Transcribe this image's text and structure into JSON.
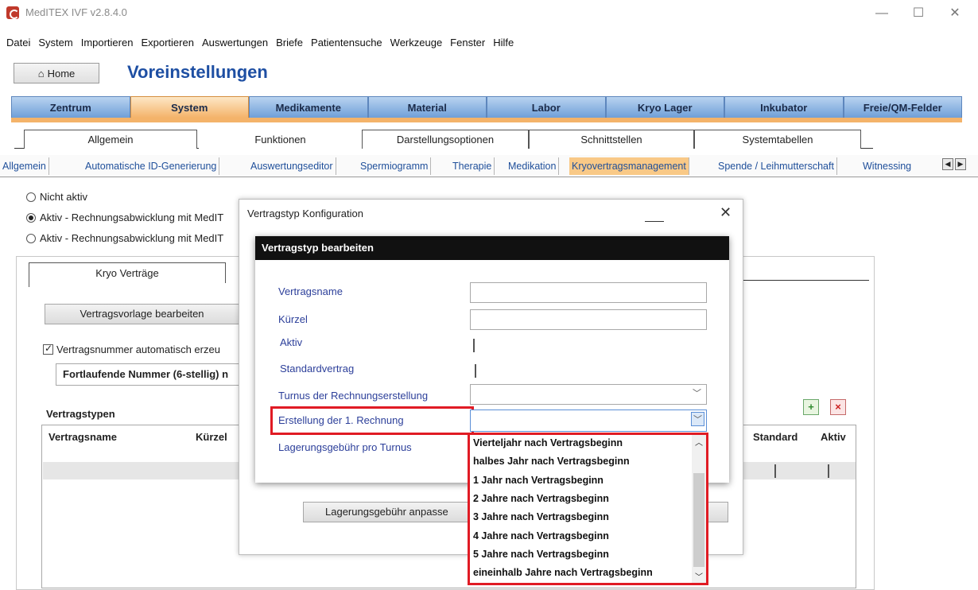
{
  "window": {
    "title": "MedITEX IVF v2.8.4.0",
    "minimize": "—",
    "maximize": "☐",
    "close": "✕"
  },
  "menu": [
    "Datei",
    "System",
    "Importieren",
    "Exportieren",
    "Auswertungen",
    "Briefe",
    "Patientensuche",
    "Werkzeuge",
    "Fenster",
    "Hilfe"
  ],
  "header": {
    "home_label": "Home",
    "heading": "Voreinstellungen"
  },
  "main_tabs": [
    "Zentrum",
    "System",
    "Medikamente",
    "Material",
    "Labor",
    "Kryo Lager",
    "Inkubator",
    "Freie/QM-Felder"
  ],
  "sub_tabs": [
    "Allgemein",
    "Funktionen",
    "Darstellungsoptionen",
    "Schnittstellen",
    "Systemtabellen"
  ],
  "third_tabs": [
    "Allgemein",
    "Automatische ID-Generierung",
    "Auswertungseditor",
    "Spermiogramm",
    "Therapie",
    "Medikation",
    "Kryovertragsmanagement",
    "Spende / Leihmutterschaft",
    "Witnessing"
  ],
  "radios": [
    {
      "label": "Nicht aktiv",
      "checked": false
    },
    {
      "label": "Aktiv - Rechnungsabwicklung mit MedIT",
      "checked": true
    },
    {
      "label": "Aktiv - Rechnungsabwicklung mit MedIT",
      "checked": false
    }
  ],
  "panel": {
    "tab_label": "Kryo Verträge",
    "edit_template_button": "Vertragsvorlage bearbeiten",
    "auto_number_label": "Vertragsnummer automatisch erzeu",
    "number_format": "Fortlaufende Nummer (6-stellig) n",
    "types_heading": "Vertragstypen",
    "columns": {
      "name": "Vertragsname",
      "short": "Kürzel",
      "standard": "Standard",
      "active": "Aktiv"
    },
    "fee_button": "Lagerungsgebühr anpasse"
  },
  "dialog": {
    "title": "Vertragstyp Konfiguration",
    "close": "✕",
    "heading": "Vertragstyp bearbeiten",
    "labels": {
      "name": "Vertragsname",
      "short": "Kürzel",
      "active": "Aktiv",
      "standard": "Standardvertrag",
      "turnus": "Turnus der Rechnungserstellung",
      "first_invoice": "Erstellung der 1. Rechnung",
      "fee": "Lagerungsgebühr pro Turnus"
    }
  },
  "dropdown": {
    "options": [
      "Vierteljahr nach Vertragsbeginn",
      "halbes Jahr nach Vertragsbeginn",
      "1 Jahr nach Vertragsbeginn",
      "2 Jahre nach Vertragsbeginn",
      "3 Jahre nach Vertragsbeginn",
      "4 Jahre nach Vertragsbeginn",
      "5 Jahre nach Vertragsbeginn",
      "eineinhalb Jahre nach Vertragsbeginn"
    ]
  },
  "colors": {
    "accent_orange": "#f4b36a",
    "tab_blue": "#6f9fd8",
    "highlight_red": "#e01b24",
    "heading_blue": "#1e4fa3"
  }
}
